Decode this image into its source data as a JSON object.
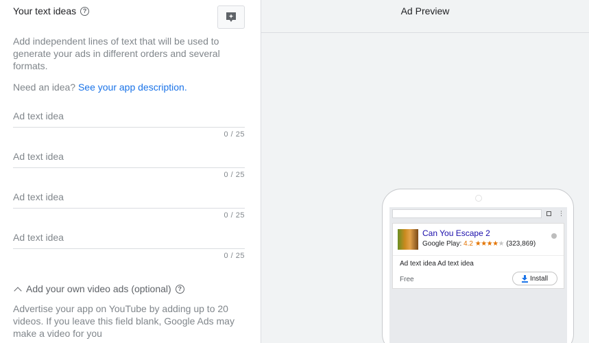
{
  "left_panel": {
    "title": "Your text ideas",
    "help_glyph": "?",
    "description": "Add independent lines of text that will be used to generate your ads in different orders and several formats.",
    "need_idea_prefix": "Need an idea?",
    "need_idea_link": "See your app description.",
    "fields": [
      {
        "placeholder": "Ad text idea",
        "value": "",
        "counter": "0 / 25"
      },
      {
        "placeholder": "Ad text idea",
        "value": "",
        "counter": "0 / 25"
      },
      {
        "placeholder": "Ad text idea",
        "value": "",
        "counter": "0 / 25"
      },
      {
        "placeholder": "Ad text idea",
        "value": "",
        "counter": "0 / 25"
      }
    ],
    "video_toggle_label": "Add your own video ads (optional)",
    "video_description": "Advertise your app on YouTube by adding up to 20 videos. If you leave this field blank, Google Ads may make a video for you"
  },
  "preview": {
    "header": "Ad Preview",
    "menu_glyph": "⋮",
    "ad": {
      "app_name": "Can You Escape 2",
      "store_label": "Google Play:",
      "rating": "4.2",
      "stars_filled": "★★★★",
      "stars_empty": "★",
      "review_count": "(323,869)",
      "ad_text": "Ad text idea Ad text idea",
      "price": "Free",
      "install_label": "Install"
    }
  },
  "colors": {
    "link": "#1a73e8",
    "ad_title": "#1a0dab",
    "rating": "#e37400",
    "panel_bg": "#f1f3f4"
  }
}
